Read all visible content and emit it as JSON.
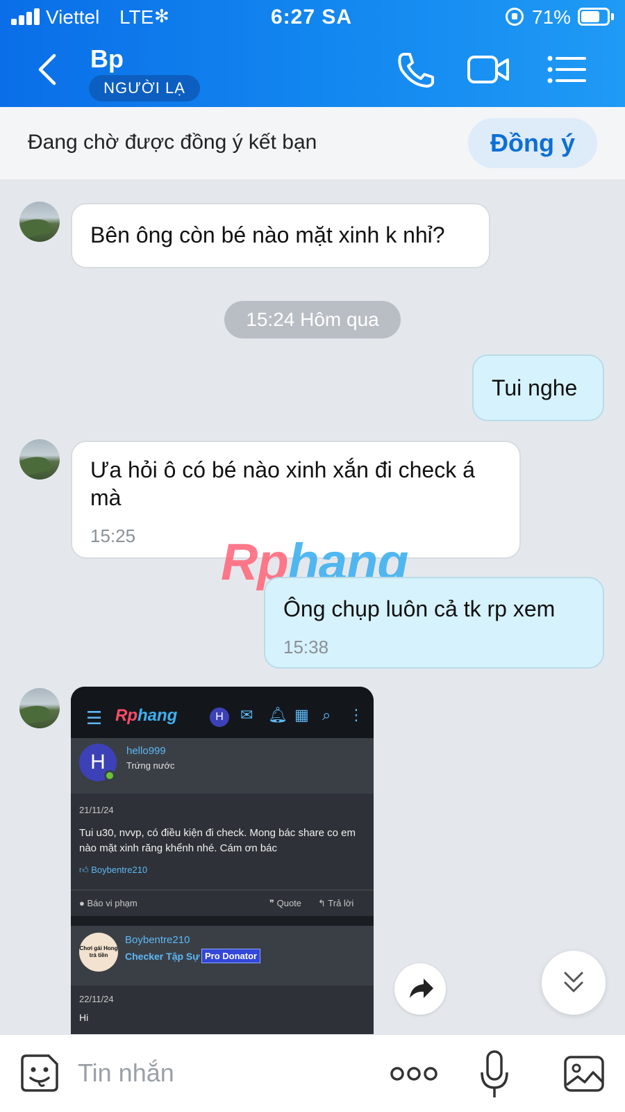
{
  "status_bar": {
    "carrier": "Viettel",
    "network": "LTE",
    "time": "6:27 SA",
    "battery_percent": "71%",
    "battery_level": 0.71
  },
  "header": {
    "title": "Bp",
    "badge": "NGƯỜI LẠ"
  },
  "friend_request": {
    "text": "Đang chờ được đồng ý kết bạn",
    "accept_label": "Đồng ý"
  },
  "messages": [
    {
      "side": "in",
      "text": "Bên ông còn bé nào mặt xinh k nhỉ?"
    },
    {
      "side": "out",
      "text": "Tui nghe"
    },
    {
      "side": "in",
      "text": "Ưa hỏi ô có bé nào xinh xắn đi check á mà",
      "time": "15:25"
    },
    {
      "side": "out",
      "text": "Ông chụp luôn cả tk rp xem",
      "time": "15:38"
    }
  ],
  "time_separator": "15:24 Hôm qua",
  "watermark": {
    "part1": "Rp",
    "part2": "hang"
  },
  "screenshot": {
    "logo_part1": "Rp",
    "logo_part2": "hang",
    "header_avatar_letter": "H",
    "post1": {
      "avatar_letter": "H",
      "username": "hello999",
      "rank": "Trứng nước",
      "date": "21/11/24",
      "content": "Tui u30, nvvp, có điều kiện đi check. Mong bác share co em nào mặt xinh răng khểnh nhé. Cám ơn bác",
      "liked_by": "Boybentre210",
      "report": "Báo vi phạm",
      "quote": "Quote",
      "reply": "Trả lời"
    },
    "post2": {
      "avatar_text": "Chơi gái Hong trả tiền",
      "username": "Boybentre210",
      "rank": "Checker Tập Sự",
      "badge": "Pro Donator",
      "date": "22/11/24",
      "content_preview": "Hi"
    }
  },
  "input": {
    "placeholder": "Tin nhắn"
  },
  "icons": {
    "back": "chevron-left-icon",
    "call": "phone-icon",
    "video": "video-camera-icon",
    "menu": "list-menu-icon",
    "emoji": "sticker-face-icon",
    "more": "more-dots-icon",
    "mic": "microphone-icon",
    "image": "image-gallery-icon",
    "forward": "share-forward-icon",
    "scroll_down": "double-chevron-down-icon"
  },
  "colors": {
    "header_blue": "#1388f0",
    "accent_blue": "#0c6fd6",
    "outgoing_bubble": "#d6f2fd",
    "incoming_bubble": "#ffffff",
    "chat_background": "#e4e8ed"
  }
}
